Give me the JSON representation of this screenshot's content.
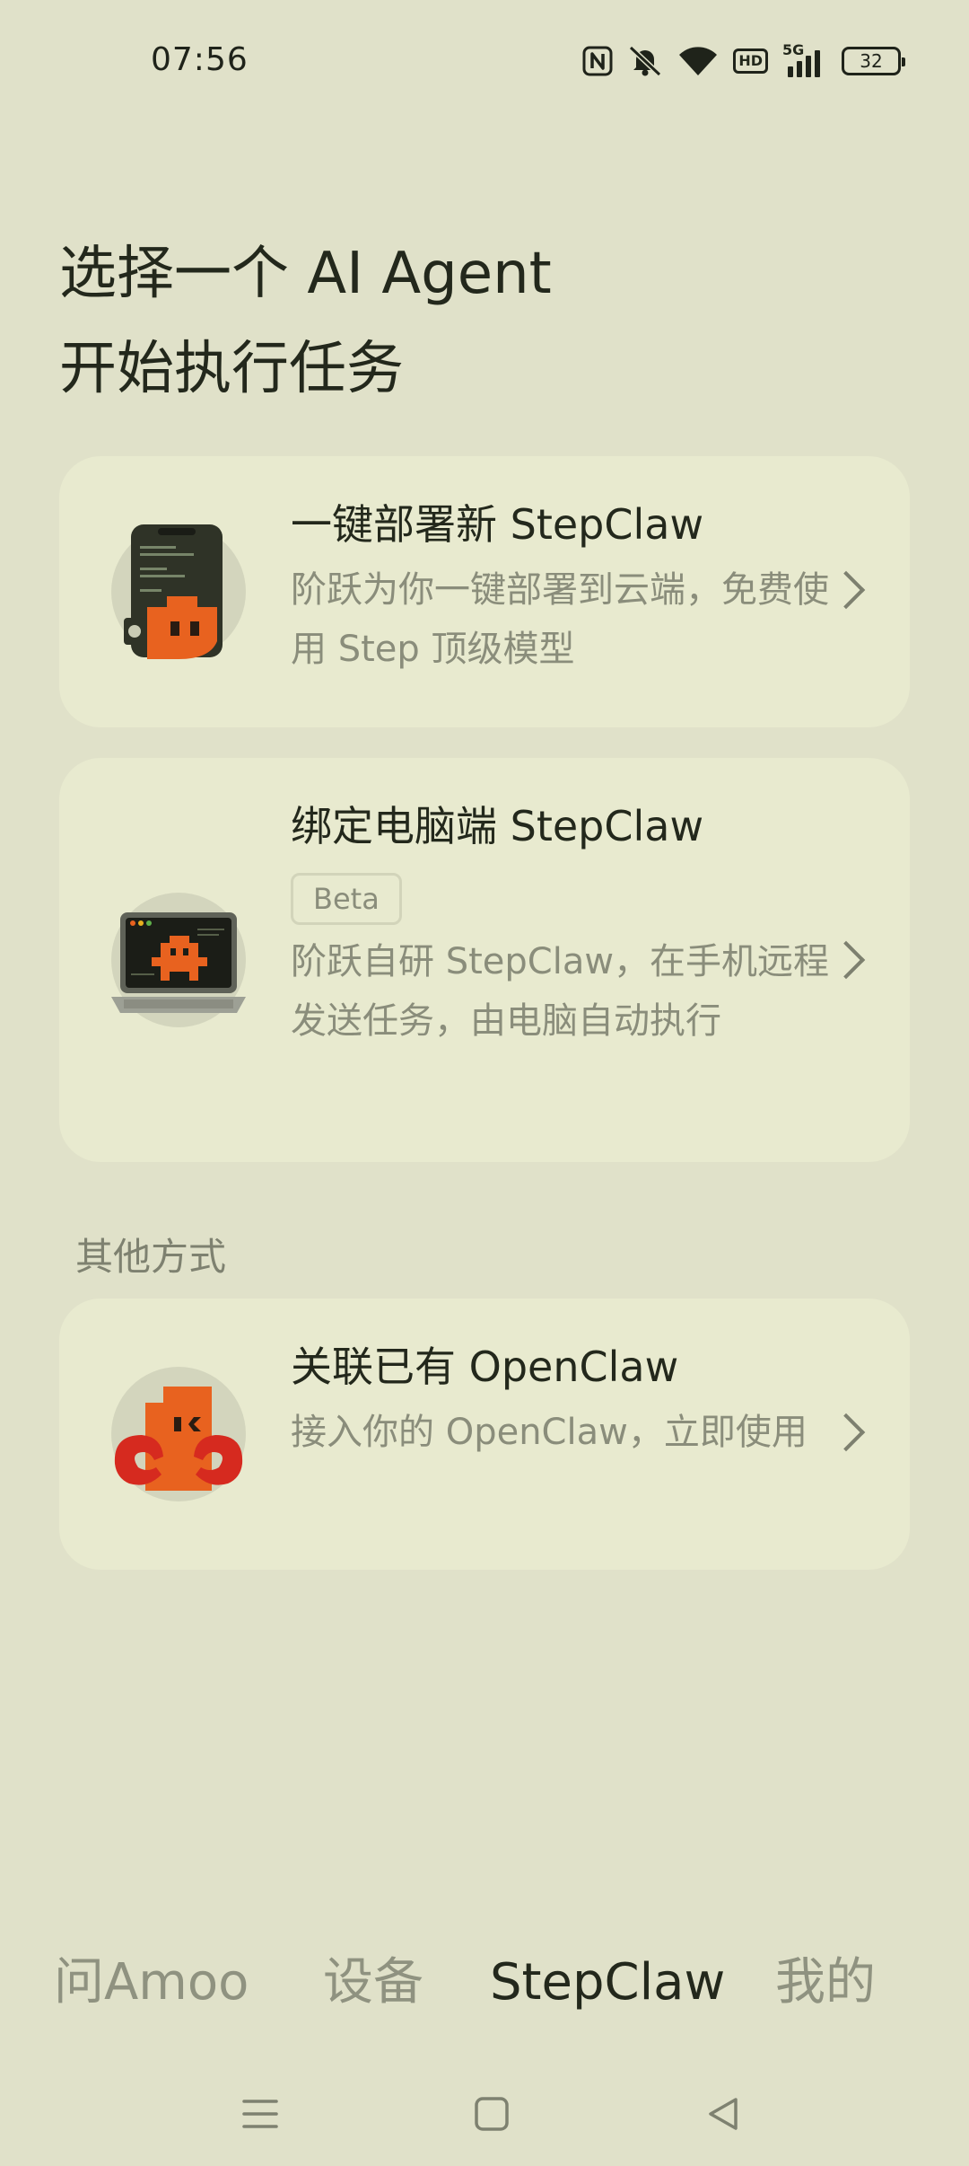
{
  "status_bar": {
    "time": "07:56",
    "network_badge": "HD",
    "network_type": "5G",
    "battery": "32",
    "icons": [
      "nfc-icon",
      "mute-icon",
      "wifi-icon",
      "hd-icon",
      "signal-5g-icon",
      "battery-icon"
    ]
  },
  "heading": {
    "line1": "选择一个 AI Agent",
    "line2": "开始执行任务"
  },
  "cards": [
    {
      "title": "一键部署新 StepClaw",
      "desc": "阶跃为你一键部署到云端，免费使用 Step 顶级模型",
      "icon": "phone-mascot-icon"
    },
    {
      "title": "绑定电脑端 StepClaw",
      "badge": "Beta",
      "desc": "阶跃自研 StepClaw，在手机远程发送任务，由电脑自动执行",
      "icon": "laptop-mascot-icon"
    }
  ],
  "other": {
    "section_label": "其他方式",
    "card": {
      "title": "关联已有 OpenClaw",
      "desc": "接入你的 OpenClaw，立即使用",
      "icon": "claw-mascot-icon"
    }
  },
  "tabs": [
    {
      "label": "问Amoo",
      "active": false
    },
    {
      "label": "设备",
      "active": false
    },
    {
      "label": "StepClaw",
      "active": true
    },
    {
      "label": "我的",
      "active": false
    }
  ],
  "colors": {
    "background": "#e0e1c9",
    "card": "#e8eacf",
    "accent_orange": "#e8621f",
    "text_primary": "#23281c",
    "text_secondary": "#8a8d7b"
  }
}
